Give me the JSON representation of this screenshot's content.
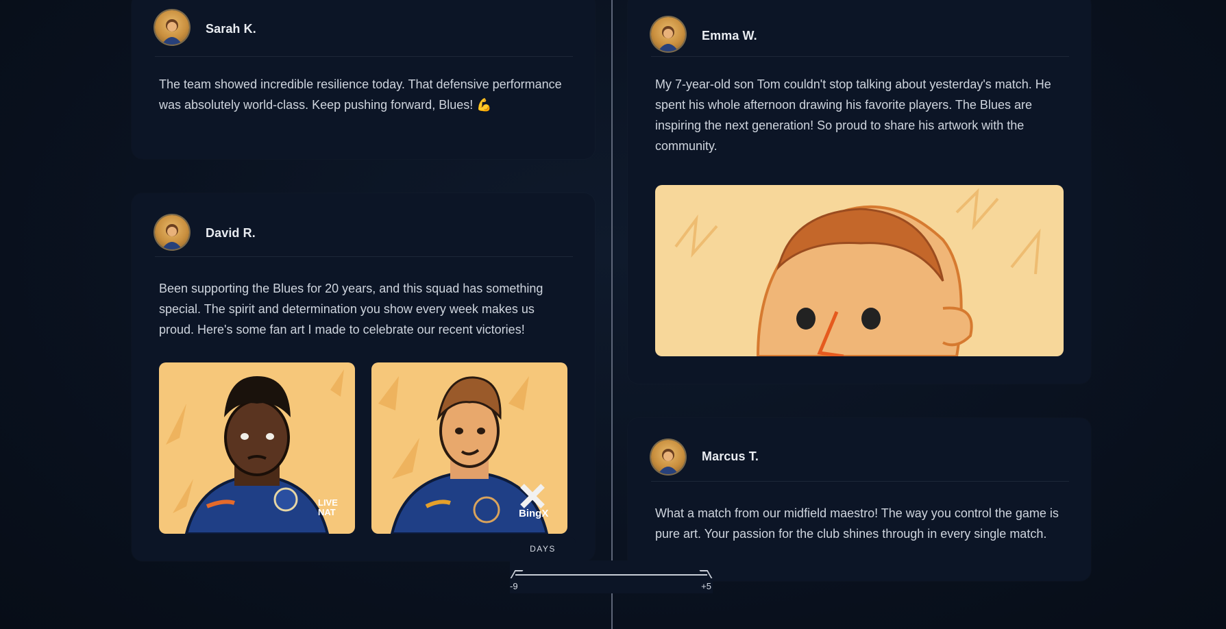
{
  "posts": [
    {
      "author": "Sarah K.",
      "text": "The team showed incredible resilience today. That defensive performance was absolutely world-class. Keep pushing forward, Blues! 💪"
    },
    {
      "author": "David R.",
      "text": "Been supporting the Blues for 20 years, and this squad has something special. The spirit and determination you show every week makes us proud. Here's some fan art I made to celebrate our recent victories!",
      "images": [
        {
          "kit_text": "LIVE NAT",
          "icon": "player-portrait-icon"
        },
        {
          "kit_text": "BingX",
          "icon": "player-portrait-icon"
        }
      ]
    },
    {
      "author": "Emma W.",
      "text": "My 7-year-old son Tom couldn't stop talking about yesterday's match. He spent his whole afternoon drawing his favorite players. The Blues are inspiring the next generation! So proud to share his artwork with the community.",
      "images": [
        {
          "icon": "child-drawing-icon"
        }
      ]
    },
    {
      "author": "Marcus T.",
      "text": "What a match from our midfield maestro! The way you control the game is pure art. Your passion for the club shines through in every single match."
    }
  ],
  "timeline": {
    "label": "DAYS",
    "min_label": "-9",
    "max_label": "+5"
  },
  "colors": {
    "card": "#0c1526",
    "background": "#0a1220",
    "art_background": "#f6c77a",
    "kit_blue": "#1f3f86"
  }
}
